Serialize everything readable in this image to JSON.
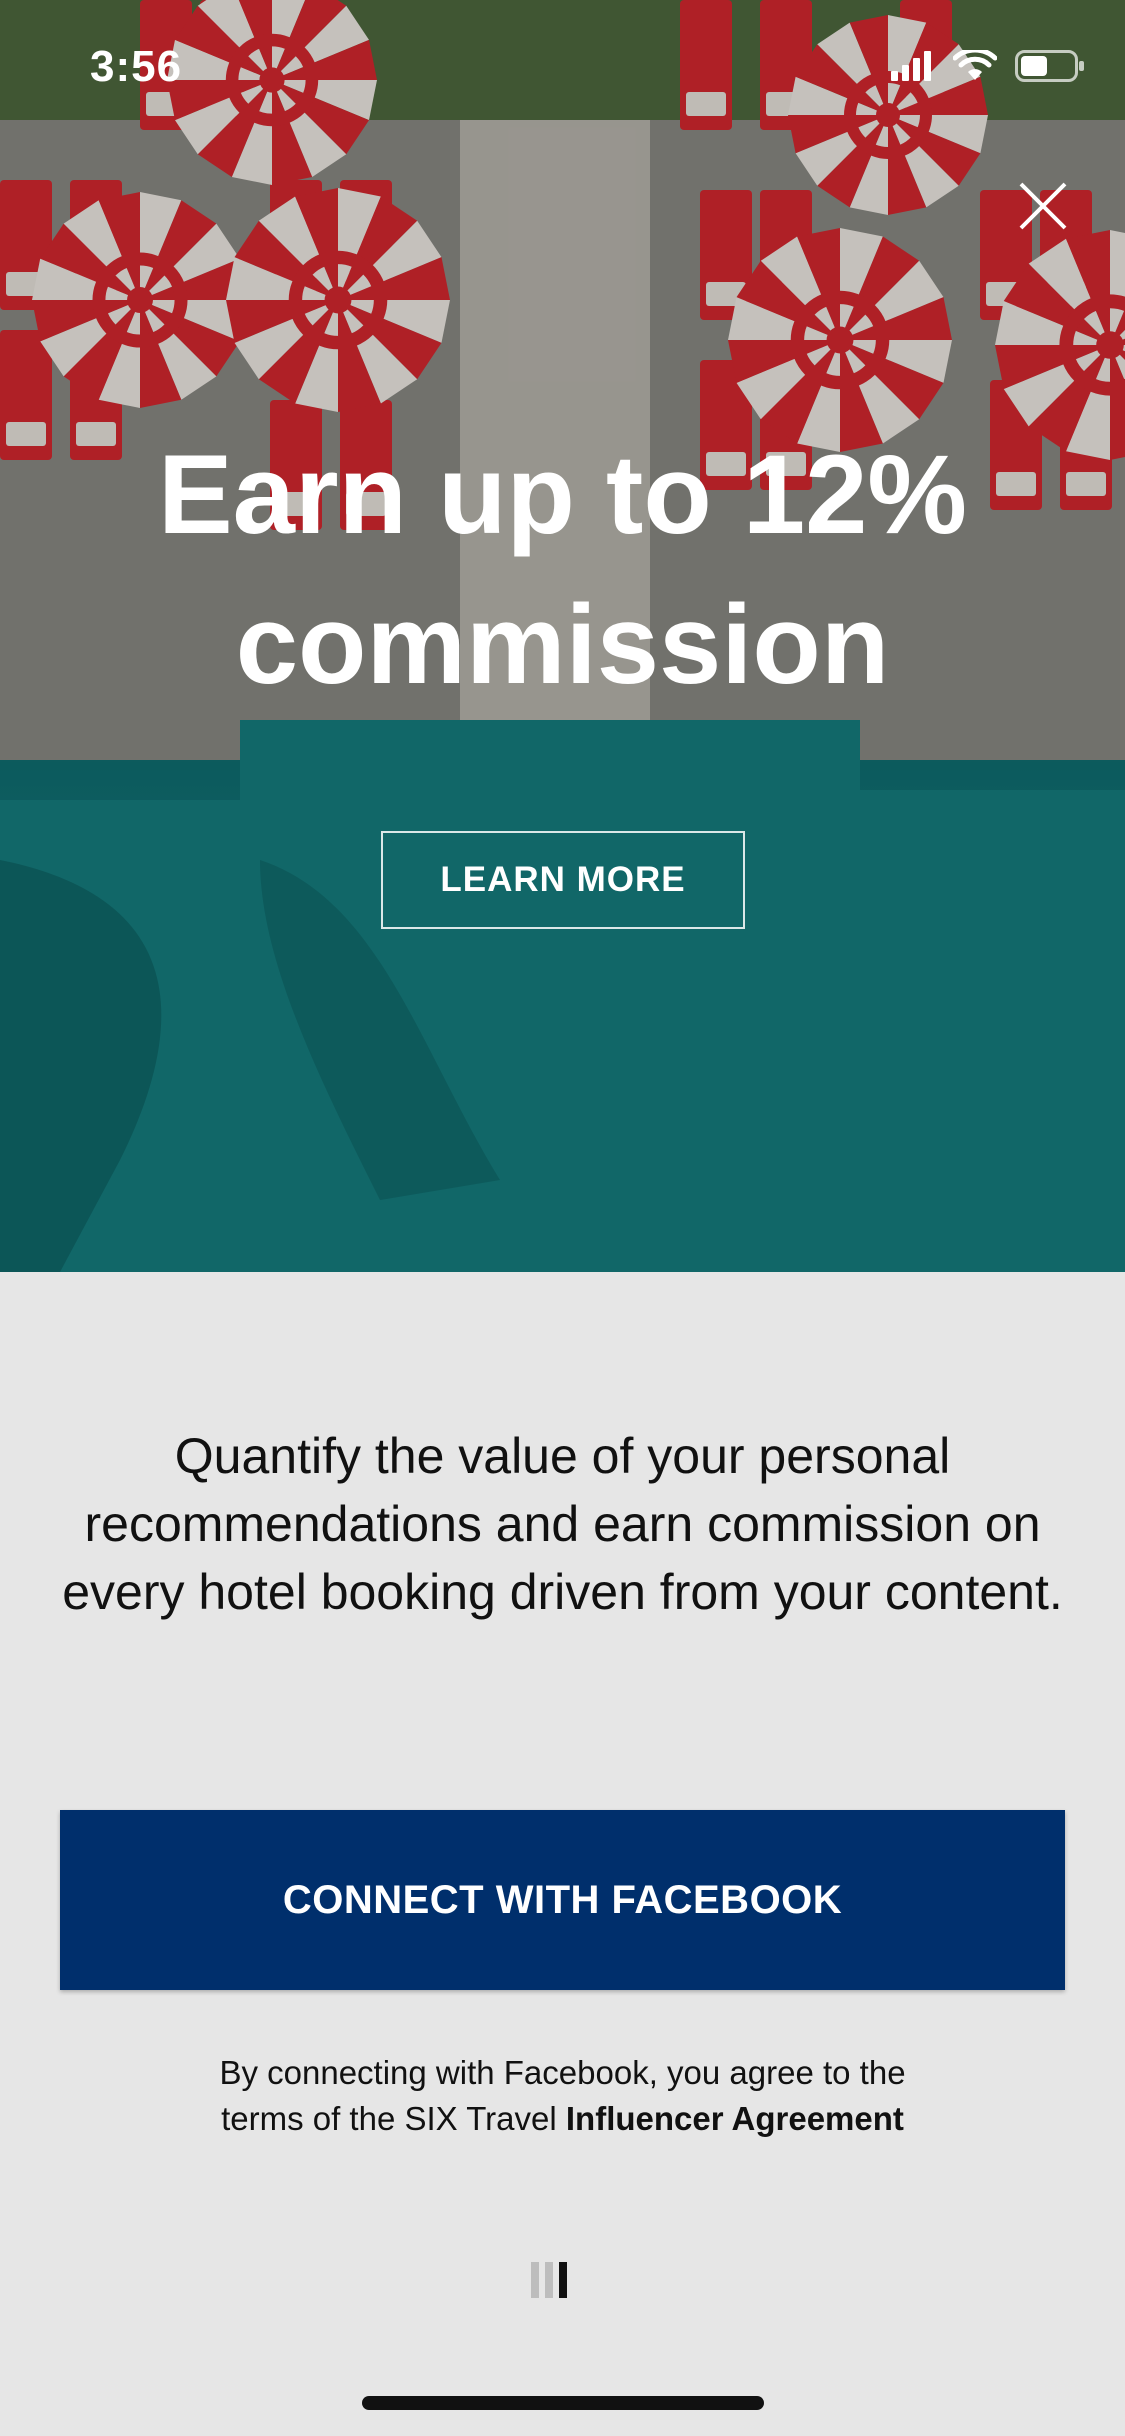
{
  "status_bar": {
    "time": "3:56",
    "icons": [
      "signal-icon",
      "wifi-icon",
      "battery-icon"
    ]
  },
  "hero": {
    "title_line1": "Earn up to 12%",
    "title_line2": "commission",
    "learn_more_label": "LEARN MORE",
    "close_icon": "close-icon"
  },
  "content": {
    "description": "Quantify the value of your personal recommendations and earn commission on every hotel booking driven from your content.",
    "connect_button_label": "CONNECT WITH FACEBOOK",
    "terms_prefix": "By connecting with Facebook, you agree to the terms of the SIX Travel ",
    "terms_link": "Influencer Agreement"
  },
  "pager": {
    "total": 3,
    "active_index": 2
  },
  "colors": {
    "button_bg": "#002f6c",
    "page_bg": "#e6e6e6",
    "accent_red": "#d6282f",
    "pool_teal": "#157e7f"
  }
}
